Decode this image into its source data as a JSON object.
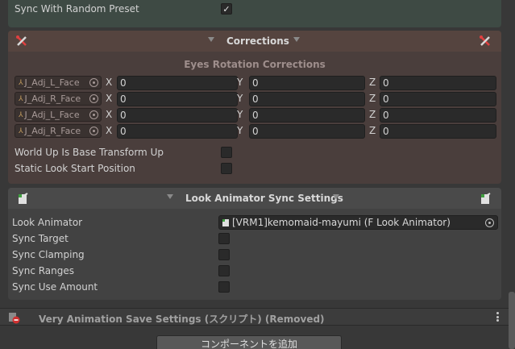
{
  "top": {
    "sync_random_preset_label": "Sync With Random Preset",
    "sync_random_preset_checked": true
  },
  "corrections": {
    "title": "Corrections",
    "subtitle": "Eyes Rotation Corrections",
    "rows": [
      {
        "bone": "J_Adj_L_Face",
        "x": "0",
        "y": "0",
        "z": "0"
      },
      {
        "bone": "J_Adj_R_Face",
        "x": "0",
        "y": "0",
        "z": "0"
      },
      {
        "bone": "J_Adj_L_Face",
        "x": "0",
        "y": "0",
        "z": "0"
      },
      {
        "bone": "J_Adj_R_Face",
        "x": "0",
        "y": "0",
        "z": "0"
      }
    ],
    "axis_x": "X",
    "axis_y": "Y",
    "axis_z": "Z",
    "world_up_label": "World Up Is Base Transform Up",
    "static_look_label": "Static Look Start Position"
  },
  "look_sync": {
    "title": "Look Animator Sync Settings",
    "look_animator_label": "Look Animator",
    "look_animator_value": "[VRM1]kemomaid-mayumi (F Look Animator)",
    "sync_target_label": "Sync Target",
    "sync_clamping_label": "Sync Clamping",
    "sync_ranges_label": "Sync Ranges",
    "sync_use_amount_label": "Sync Use Amount"
  },
  "component": {
    "title": "Very Animation Save Settings (スクリプト) (Removed)"
  },
  "add_component_label": "コンポーネントを追加",
  "colors": {
    "corrections_bg": "#4a3e3c",
    "look_bg": "#424242",
    "top_bg": "#3e4a44"
  }
}
